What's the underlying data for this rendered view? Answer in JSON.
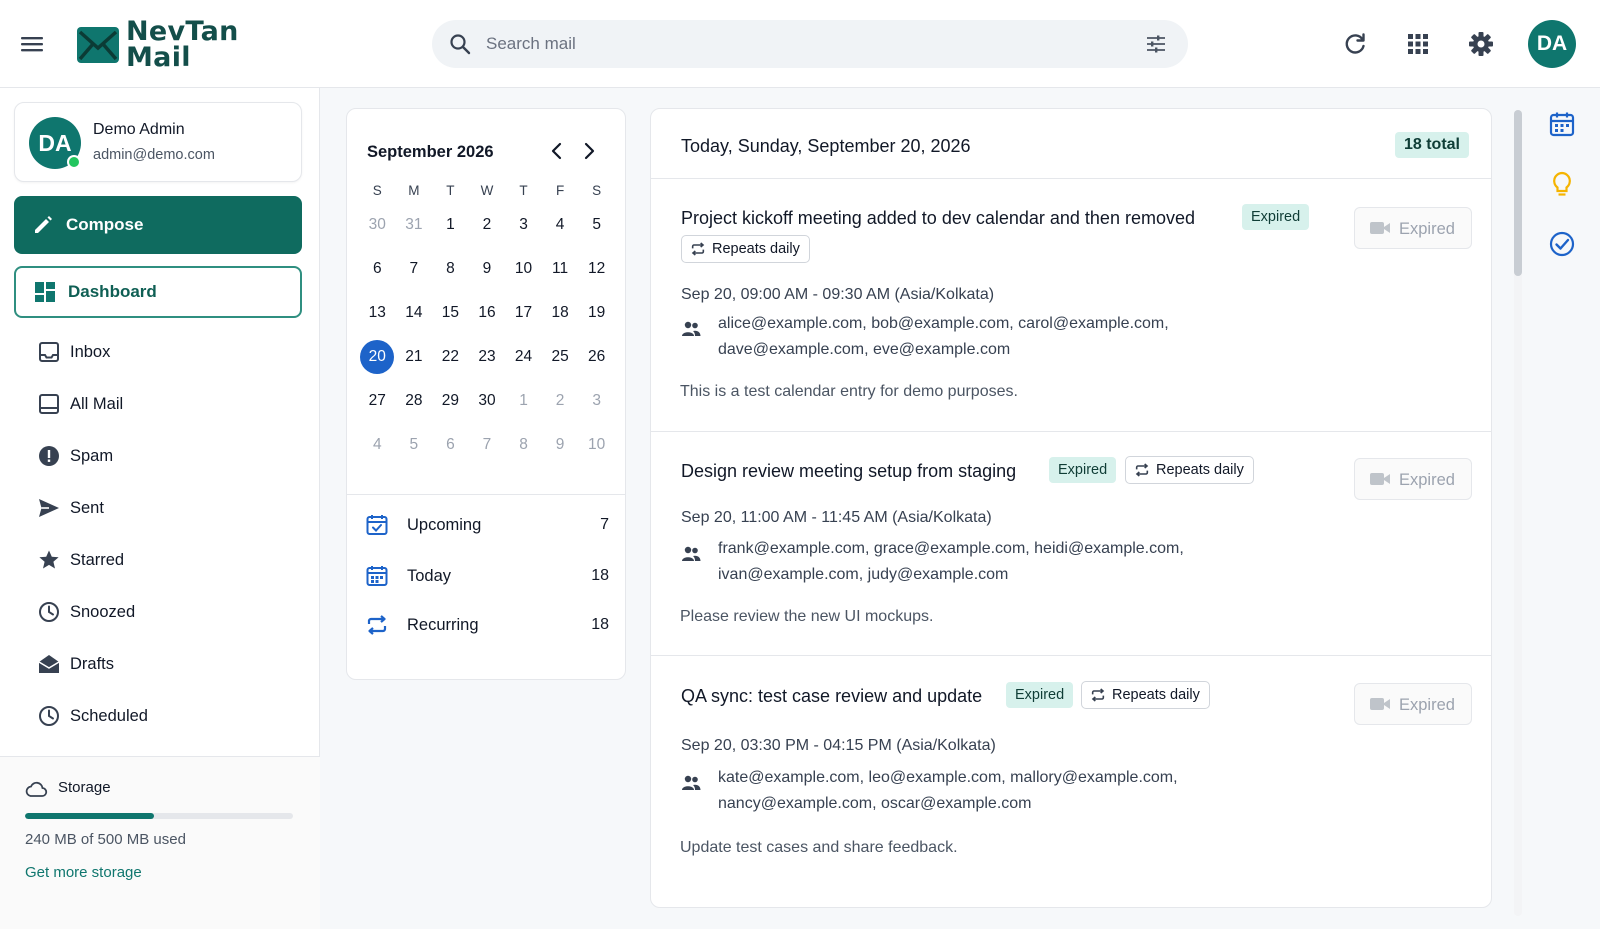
{
  "header": {
    "brand_line1": "NevTan",
    "brand_line2": "Mail",
    "search_placeholder": "Search mail",
    "avatar_initials": "DA"
  },
  "sidebar": {
    "profile": {
      "initials": "DA",
      "name": "Demo Admin",
      "email": "admin@demo.com"
    },
    "compose_label": "Compose",
    "dashboard_label": "Dashboard",
    "items": [
      {
        "label": "Inbox",
        "icon": "inbox-icon"
      },
      {
        "label": "All Mail",
        "icon": "all-mail-icon"
      },
      {
        "label": "Spam",
        "icon": "spam-icon"
      },
      {
        "label": "Sent",
        "icon": "sent-icon"
      },
      {
        "label": "Starred",
        "icon": "star-icon"
      },
      {
        "label": "Snoozed",
        "icon": "clock-icon"
      },
      {
        "label": "Drafts",
        "icon": "drafts-icon"
      },
      {
        "label": "Scheduled",
        "icon": "scheduled-icon"
      }
    ],
    "storage": {
      "title": "Storage",
      "used_text": "240 MB of 500 MB used",
      "used_fraction": 0.48,
      "more_label": "Get more storage"
    }
  },
  "calendar": {
    "month_label": "September 2026",
    "weekdays": [
      "S",
      "M",
      "T",
      "W",
      "T",
      "F",
      "S"
    ],
    "weeks": [
      [
        "30",
        "31",
        "1",
        "2",
        "3",
        "4",
        "5"
      ],
      [
        "6",
        "7",
        "8",
        "9",
        "10",
        "11",
        "12"
      ],
      [
        "13",
        "14",
        "15",
        "16",
        "17",
        "18",
        "19"
      ],
      [
        "20",
        "21",
        "22",
        "23",
        "24",
        "25",
        "26"
      ],
      [
        "27",
        "28",
        "29",
        "30",
        "1",
        "2",
        "3"
      ],
      [
        "4",
        "5",
        "6",
        "7",
        "8",
        "9",
        "10"
      ]
    ],
    "today": "20",
    "filters": [
      {
        "label": "Upcoming",
        "count": "7",
        "icon": "calendar-check-icon"
      },
      {
        "label": "Today",
        "count": "18",
        "icon": "calendar-today-icon"
      },
      {
        "label": "Recurring",
        "count": "18",
        "icon": "repeat-icon"
      }
    ]
  },
  "events": {
    "date_heading": "Today, Sunday, September 20, 2026",
    "total_label": "18 total",
    "expired_label": "Expired",
    "repeat_label": "Repeats daily",
    "items": [
      {
        "title": "Project kickoff meeting added to dev calendar and then removed",
        "time": "Sep 20, 09:00 AM - 09:30 AM (Asia/Kolkata)",
        "guests_line1": "alice@example.com, bob@example.com, carol@example.com,",
        "guests_line2": "dave@example.com, eve@example.com",
        "description": "This is a test calendar entry for demo purposes."
      },
      {
        "title": "Design review meeting setup from staging",
        "time": "Sep 20, 11:00 AM - 11:45 AM (Asia/Kolkata)",
        "guests_line1": "frank@example.com, grace@example.com, heidi@example.com,",
        "guests_line2": "ivan@example.com, judy@example.com",
        "description": "Please review the new UI mockups."
      },
      {
        "title": "QA sync: test case review and update",
        "time": "Sep 20, 03:30 PM - 04:15 PM (Asia/Kolkata)",
        "guests_line1": "kate@example.com, leo@example.com, mallory@example.com,",
        "guests_line2": "nancy@example.com, oscar@example.com",
        "description": "Update test cases and share feedback."
      }
    ]
  },
  "colors": {
    "brand": "#0f6b5f",
    "today_highlight": "#1d63c9",
    "badge_bg": "#d7f1ec"
  }
}
